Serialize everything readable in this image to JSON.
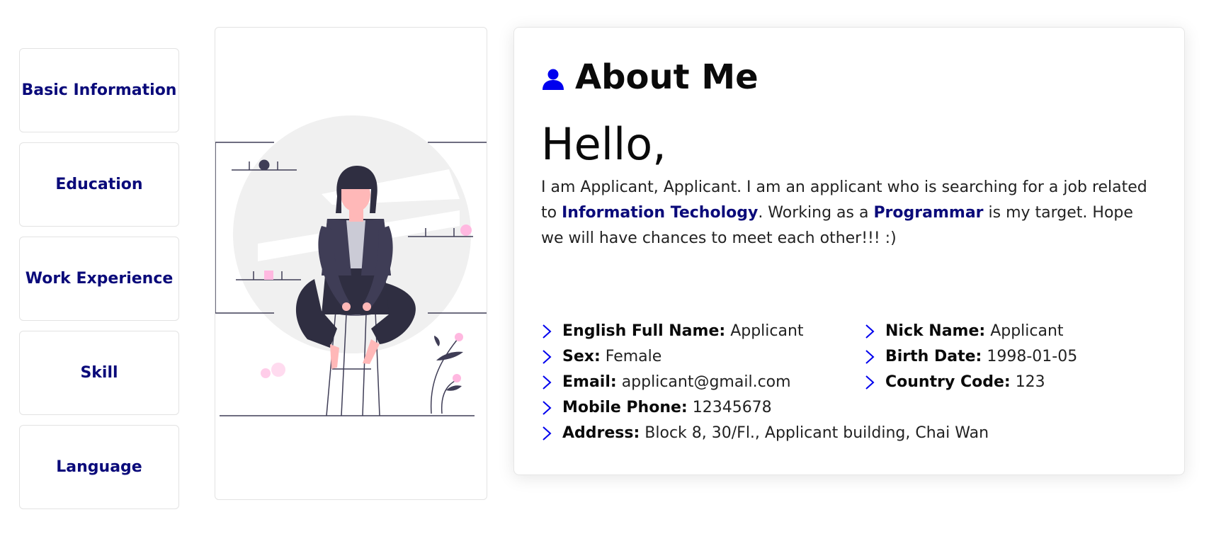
{
  "sidebar": {
    "items": [
      {
        "label": "Basic Information"
      },
      {
        "label": "Education"
      },
      {
        "label": "Work Experience"
      },
      {
        "label": "Skill"
      },
      {
        "label": "Language"
      }
    ]
  },
  "about": {
    "title": "About Me",
    "title_icon": "user-icon",
    "greeting": "Hello,",
    "intro_part1": "I am Applicant, Applicant. I am an applicant who is searching for a job related to ",
    "intro_highlight1": "Information Techology",
    "intro_part2": ". Working as a ",
    "intro_highlight2": "Programmar",
    "intro_part3": " is my target. Hope we will have chances to meet each other!!! :)",
    "highlight_color": "#0a0a7a",
    "accent_color": "#0000ee"
  },
  "details": {
    "english_full_name": {
      "label": "English Full Name:",
      "value": "Applicant"
    },
    "nick_name": {
      "label": "Nick Name:",
      "value": "Applicant"
    },
    "sex": {
      "label": "Sex:",
      "value": "Female"
    },
    "birth_date": {
      "label": "Birth Date:",
      "value": "1998-01-05"
    },
    "email": {
      "label": "Email:",
      "value": "applicant@gmail.com"
    },
    "country_code": {
      "label": "Country Code:",
      "value": "123"
    },
    "mobile_phone": {
      "label": "Mobile Phone:",
      "value": "12345678"
    },
    "address": {
      "label": "Address:",
      "value": "Block 8, 30/Fl., Applicant building, Chai Wan"
    }
  }
}
